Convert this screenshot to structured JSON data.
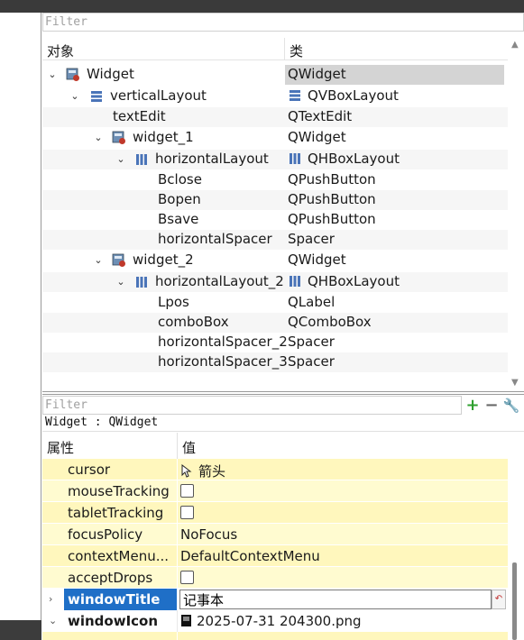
{
  "object_inspector": {
    "filter_placeholder": "Filter",
    "header_object": "对象",
    "header_class": "类",
    "rows": [
      {
        "name": "Widget",
        "class": "QWidget"
      },
      {
        "name": "verticalLayout",
        "class": "QVBoxLayout"
      },
      {
        "name": "textEdit",
        "class": "QTextEdit"
      },
      {
        "name": "widget_1",
        "class": "QWidget"
      },
      {
        "name": "horizontalLayout",
        "class": "QHBoxLayout"
      },
      {
        "name": "Bclose",
        "class": "QPushButton"
      },
      {
        "name": "Bopen",
        "class": "QPushButton"
      },
      {
        "name": "Bsave",
        "class": "QPushButton"
      },
      {
        "name": "horizontalSpacer",
        "class": "Spacer"
      },
      {
        "name": "widget_2",
        "class": "QWidget"
      },
      {
        "name": "horizontalLayout_2",
        "class": "QHBoxLayout"
      },
      {
        "name": "Lpos",
        "class": "QLabel"
      },
      {
        "name": "comboBox",
        "class": "QComboBox"
      },
      {
        "name": "horizontalSpacer_2",
        "class": "Spacer"
      },
      {
        "name": "horizontalSpacer_3",
        "class": "Spacer"
      }
    ]
  },
  "property_editor": {
    "filter_placeholder": "Filter",
    "title": "Widget : QWidget",
    "header_property": "属性",
    "header_value": "值",
    "rows": [
      {
        "name": "cursor",
        "value": "箭头"
      },
      {
        "name": "mouseTracking",
        "value": ""
      },
      {
        "name": "tabletTracking",
        "value": ""
      },
      {
        "name": "focusPolicy",
        "value": "NoFocus"
      },
      {
        "name": "contextMenu...",
        "value": "DefaultContextMenu"
      },
      {
        "name": "acceptDrops",
        "value": ""
      },
      {
        "name": "windowTitle",
        "value": "记事本"
      },
      {
        "name": "windowIcon",
        "value": "2025-07-31 204300.png"
      }
    ],
    "colors": {
      "accent": "#1f6fc7",
      "row_bg": "#fffbd0",
      "add_green": "#2fa02f"
    }
  }
}
